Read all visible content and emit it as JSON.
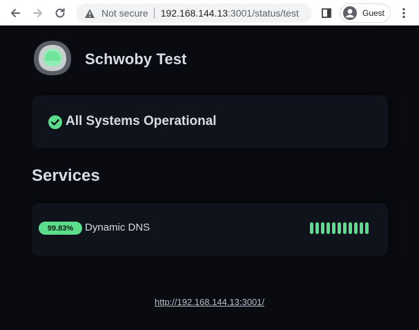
{
  "browser": {
    "security_label": "Not secure",
    "url_host": "192.168.144.13",
    "url_path": ":3001/status/test",
    "profile_label": "Guest"
  },
  "page": {
    "site_title": "Schwoby Test",
    "overall_status": "All Systems Operational",
    "services_heading": "Services",
    "services": [
      {
        "uptime": "99.83%",
        "name": "Dynamic DNS",
        "beats": 11,
        "beat_status": "up"
      }
    ],
    "footer_link": "http://192.168.144.13:3001/"
  },
  "colors": {
    "background": "#090b10",
    "card": "#0f131b",
    "accent_green": "#5cdd8b",
    "text": "#d6dbe4"
  }
}
